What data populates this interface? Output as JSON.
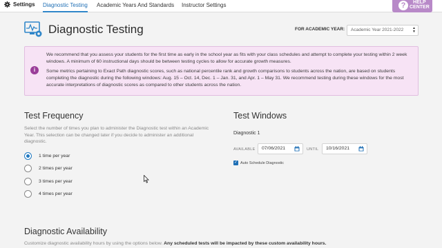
{
  "nav": {
    "settings_label": "Settings",
    "tabs": [
      {
        "label": "Diagnostic Testing",
        "active": true
      },
      {
        "label": "Academic Years And Standards",
        "active": false
      },
      {
        "label": "Instructor Settings",
        "active": false
      }
    ],
    "help": {
      "line1": "HELP",
      "line2": "CENTER"
    }
  },
  "header": {
    "title": "Diagnostic Testing",
    "year_label": "FOR ACADEMIC YEAR:",
    "year_value": "Academic Year 2021-2022"
  },
  "notice": {
    "p1": "We recommend that you assess your students for the first time as early in the school year as fits with your class schedules and attempt to complete your testing within 2 week windows. A minimum of 60 instructional days should be between testing cycles to allow for accurate growth measures.",
    "p2": "Some metrics pertaining to Exact Path diagnostic scores, such as national percentile rank and growth comparisons to students across the nation, are based on students completing the diagnostic during the following windows: Aug. 15 – Oct. 14, Dec. 1 – Jan. 31, and Apr. 1 – May 31. We recommend testing during these windows for the most accurate interpretations of diagnostic scores as compared to other students across the nation."
  },
  "frequency": {
    "title": "Test Frequency",
    "description": "Select the number of times you plan to administer the Diagnostic test within an Academic Year. This selection can be changed later if you decide to administer an additional diagnostic.",
    "options": [
      {
        "label": "1 time per year",
        "selected": true
      },
      {
        "label": "2 times per year",
        "selected": false
      },
      {
        "label": "3 times per year",
        "selected": false
      },
      {
        "label": "4 times per year",
        "selected": false
      }
    ]
  },
  "windows": {
    "title": "Test Windows",
    "diagnostic_label": "Diagnostic 1",
    "available_label": "AVAILABLE",
    "available_date": "07/06/2021",
    "until_label": "UNTIL",
    "until_date": "10/16/2021",
    "auto_schedule_label": "Auto Schedule Diagnostic",
    "auto_schedule_checked": true
  },
  "availability": {
    "title": "Diagnostic Availability",
    "desc_plain": "Customize diagnostic availability hours by using the options below.",
    "desc_bold": "Any scheduled tests will be impacted by these custom availability hours."
  },
  "colors": {
    "accent": "#1f6fb5",
    "help": "#b889c8",
    "notice_bg": "#f7e3f5",
    "notice_icon": "#9a3e99"
  }
}
